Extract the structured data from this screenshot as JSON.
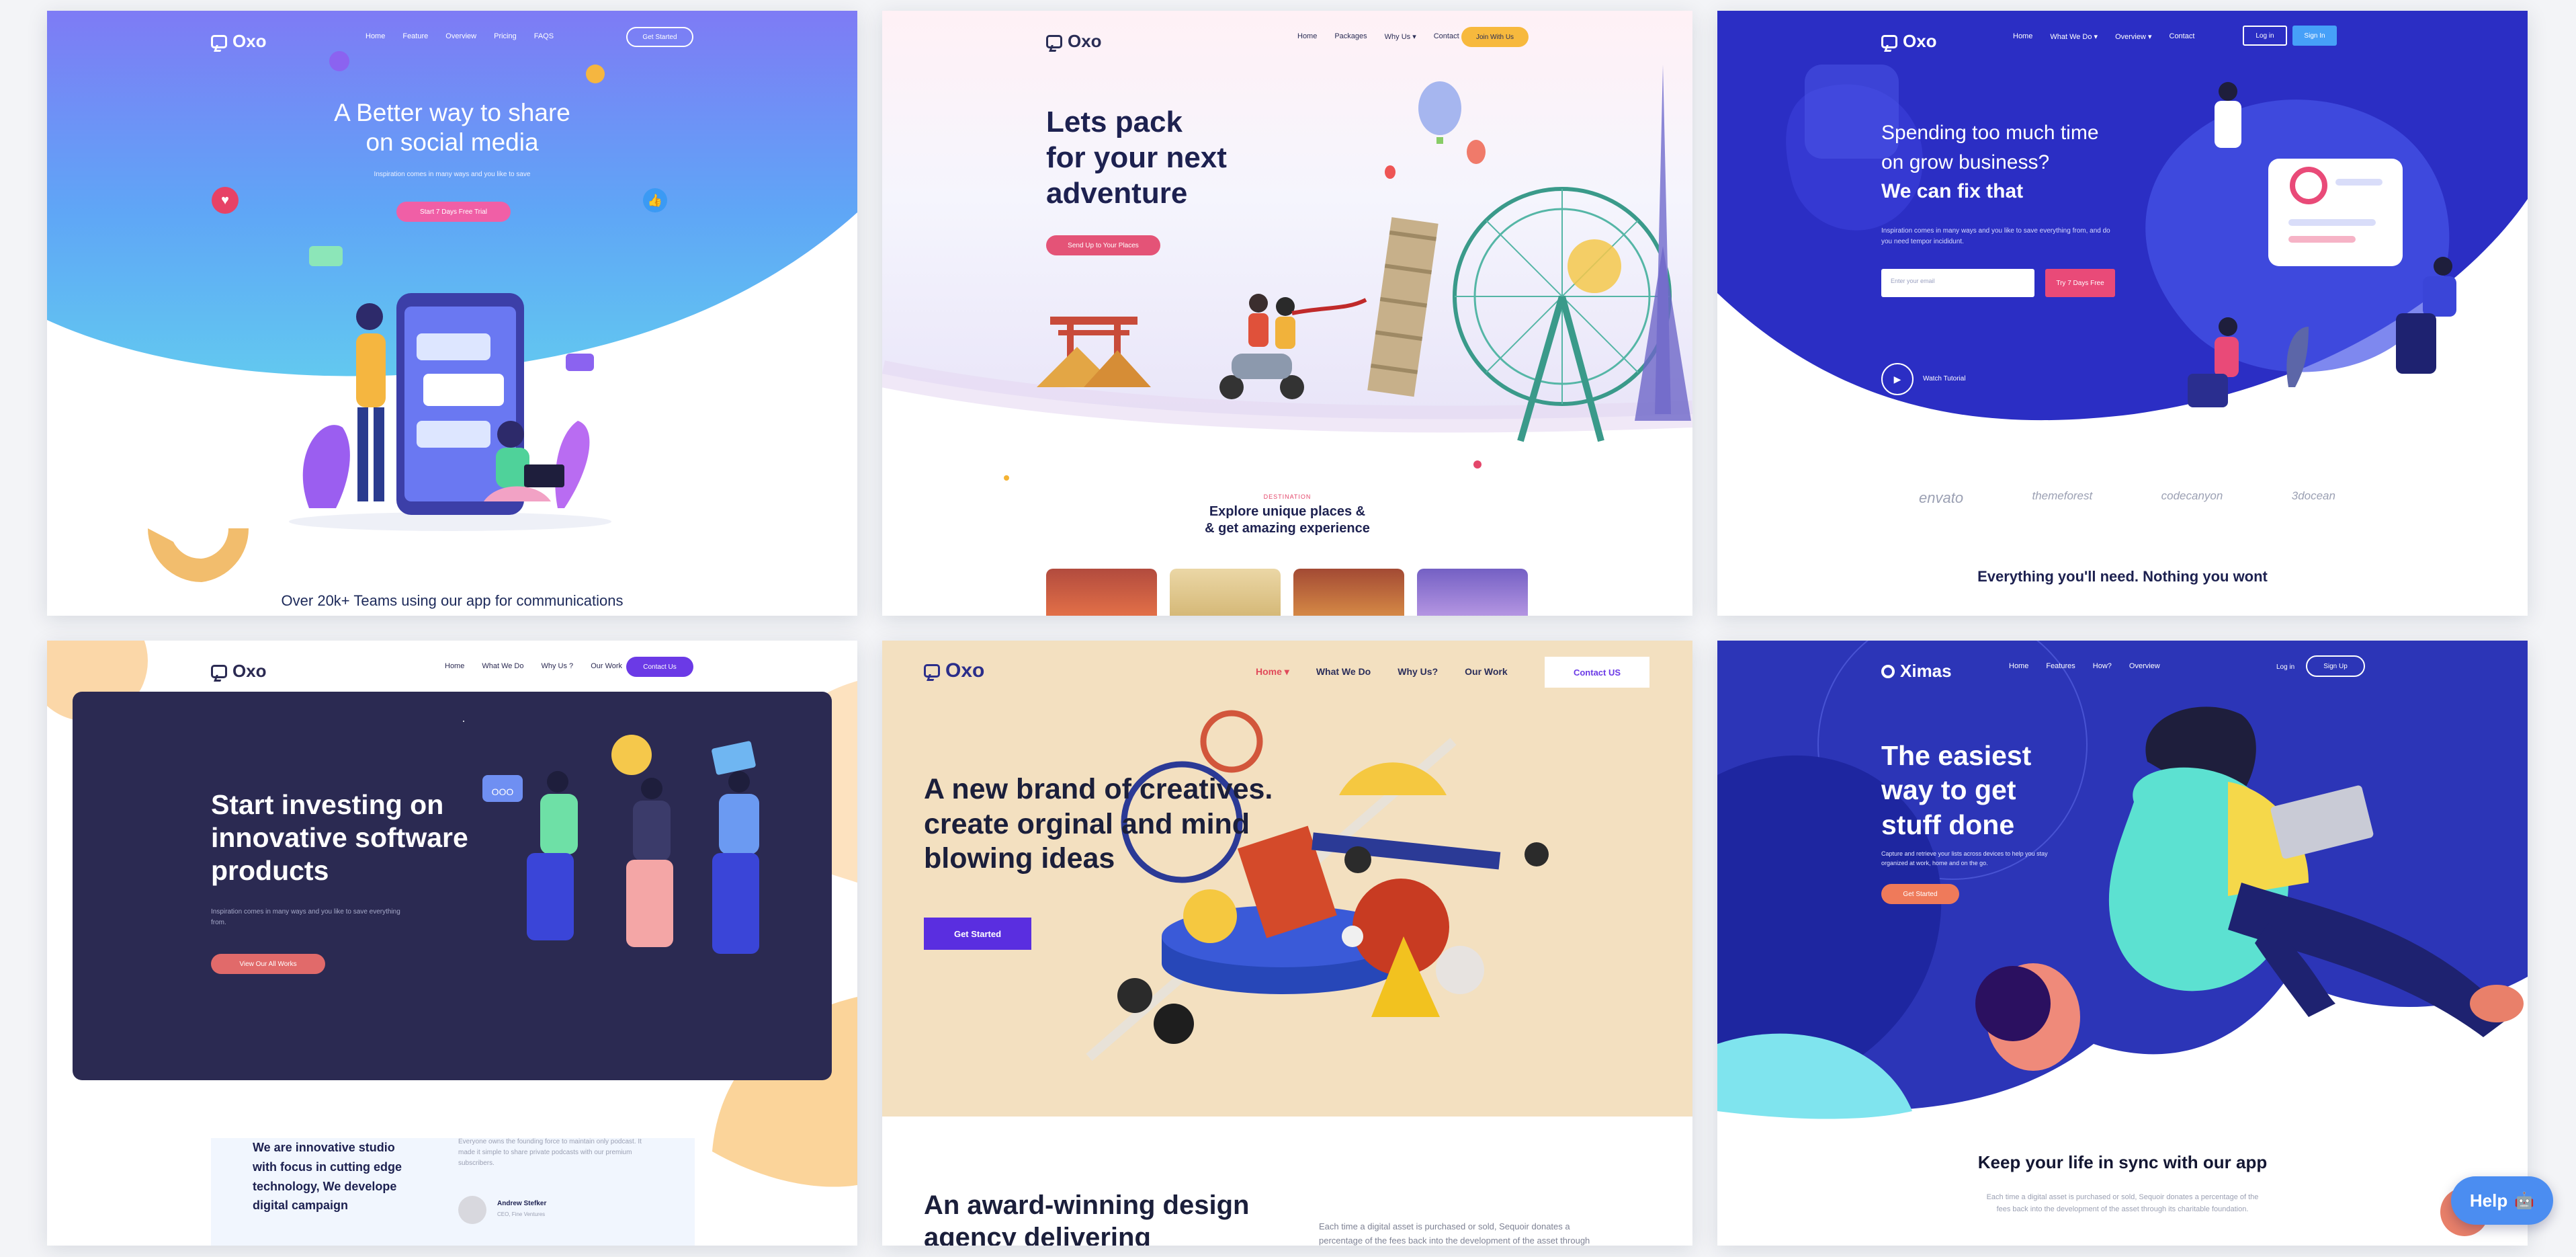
{
  "cards": {
    "social": {
      "brand": "Oxo",
      "nav": [
        "Home",
        "Feature",
        "Overview",
        "Pricing",
        "FAQS"
      ],
      "nav_button": "Get Started",
      "headline": [
        "A Better way to share",
        "on social media"
      ],
      "sub": "Inspiration comes in many ways and you like to save",
      "cta": "Start 7 Days Free Trial",
      "footer": "Over 20k+ Teams using our app for communications"
    },
    "travel": {
      "brand": "Oxo",
      "nav": [
        "Home",
        "Packages",
        "Why Us ▾",
        "Contact"
      ],
      "nav_button": "Join With Us",
      "headline": [
        "Lets pack",
        "for your next",
        "adventure"
      ],
      "cta": "Send Up to Your Places",
      "eyebrow": "DESTINATION",
      "section_title": [
        "Explore unique places &",
        "& get amazing experience"
      ]
    },
    "business": {
      "brand": "Oxo",
      "nav": [
        "Home",
        "What We Do ▾",
        "Overview ▾",
        "Contact"
      ],
      "login": "Log in",
      "signup": "Sign In",
      "headline_light": [
        "Spending too much time",
        "on grow business?"
      ],
      "headline_bold": "We can fix that",
      "sub": "Inspiration comes in many ways and you like to save everything from, and do you need tempor incididunt.",
      "input_placeholder": "Enter your email",
      "cta": "Try 7 Days Free",
      "video": "Watch Tutorial",
      "partners": [
        "envato",
        "themeforest",
        "codecanyon",
        "3docean"
      ],
      "footer": "Everything you'll need. Nothing you wont"
    },
    "invest": {
      "brand": "Oxo",
      "nav": [
        "Home",
        "What We Do",
        "Why Us ?",
        "Our Work"
      ],
      "nav_button": "Contact Us",
      "headline": [
        "Start investing on",
        "innovative software",
        "products"
      ],
      "sub": "Inspiration comes in many ways and you like to save everything from.",
      "cta": "View Our All Works",
      "about": [
        "We are innovative studio",
        "with focus in cutting edge",
        "technology, We develope",
        "digital campaign"
      ],
      "quote": "Everyone owns the founding force to maintain only podcast. It made it simple to share private podcasts with our premium subscribers.",
      "author": "Andrew Stefker",
      "author_role": "CEO, Fine Ventures",
      "bubble": "OOO"
    },
    "creative": {
      "brand": "Oxo",
      "nav": [
        "Home ▾",
        "What We Do",
        "Why Us?",
        "Our Work"
      ],
      "nav_button": "Contact US",
      "headline": [
        "A new brand of creatives.",
        "create orginal and mind",
        "blowing ideas"
      ],
      "cta": "Get Started",
      "section": [
        "An award-winning design",
        "agency delivering"
      ],
      "section_text": [
        "Each time a digital asset is purchased or sold, Sequoir donates a",
        "percentage of the fees back into the development of the asset through"
      ]
    },
    "ximas": {
      "brand": "Ximas",
      "nav": [
        "Home",
        "Features",
        "How?",
        "Overview"
      ],
      "login": "Log in",
      "signup": "Sign Up",
      "headline": [
        "The easiest",
        "way to get",
        "stuff done"
      ],
      "sub": "Capture and retrieve your lists across devices to help you stay organized at work, home and on the go.",
      "cta": "Get Started",
      "section": "Keep your life in sync with our app",
      "section_text": [
        "Each time a digital asset is purchased or sold, Sequoir donates a percentage of the",
        "fees back into the development of the asset through its charitable foundation."
      ]
    }
  },
  "help": {
    "label": "Help"
  }
}
